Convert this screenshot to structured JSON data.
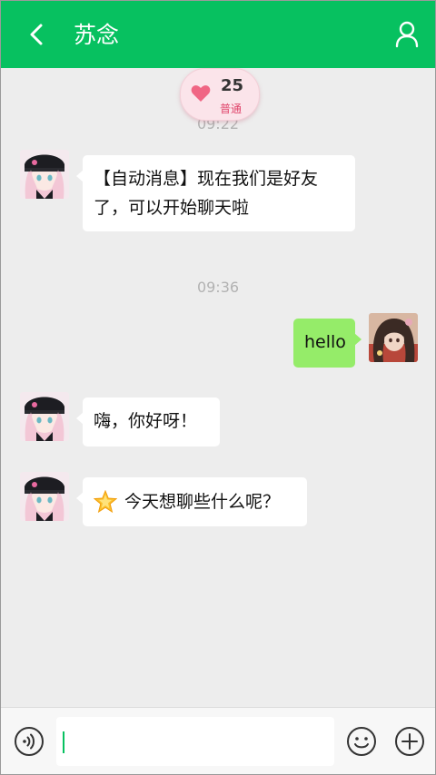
{
  "header": {
    "title": "苏念",
    "bg_color": "#07c160"
  },
  "intimacy_badge": {
    "score": "25",
    "level": "普通"
  },
  "messages": [
    {
      "type": "timestamp",
      "text": "09:22"
    },
    {
      "type": "received",
      "text": "【自动消息】现在我们是好友了，可以开始聊天啦"
    },
    {
      "type": "timestamp",
      "text": "09:36"
    },
    {
      "type": "sent",
      "text": "hello"
    },
    {
      "type": "received",
      "text": "嗨，你好呀！"
    },
    {
      "type": "received",
      "icon": "star-emoji",
      "emoji": "🌟",
      "text": "今天想聊些什么呢？"
    }
  ],
  "input_bar": {
    "value": "",
    "icons": [
      "voice-icon",
      "emoji-icon",
      "plus-icon"
    ]
  },
  "colors": {
    "sent_bubble": "#95ec69",
    "received_bubble": "#ffffff",
    "background": "#ededed"
  }
}
